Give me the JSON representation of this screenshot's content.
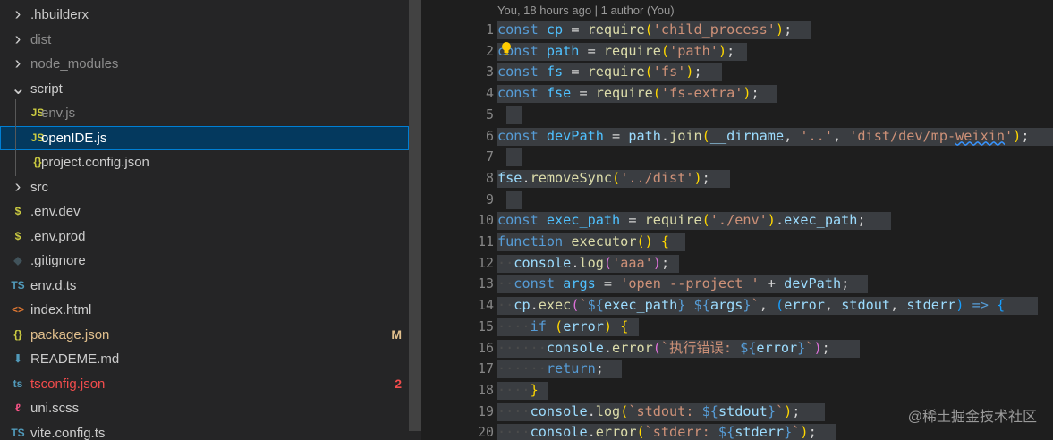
{
  "explorer": {
    "items": [
      {
        "label": ".hbuilderx",
        "kind": "folder",
        "icon": "chevron-right-icon",
        "glyph": "›",
        "depth": 0,
        "color": "#cccccc"
      },
      {
        "label": "dist",
        "kind": "folder",
        "icon": "chevron-right-icon",
        "glyph": "›",
        "depth": 0,
        "color": "#8c8c8c"
      },
      {
        "label": "node_modules",
        "kind": "folder",
        "icon": "chevron-right-icon",
        "glyph": "›",
        "depth": 0,
        "color": "#8c8c8c"
      },
      {
        "label": "script",
        "kind": "folder-open",
        "icon": "chevron-down-icon",
        "glyph": "⌄",
        "depth": 0,
        "color": "#cccccc"
      },
      {
        "label": "env.js",
        "kind": "file",
        "icon": "js-file-icon",
        "glyph": "JS",
        "iconColor": "#cbcb41",
        "depth": 1,
        "color": "#8c8c8c"
      },
      {
        "label": "openIDE.js",
        "kind": "file",
        "icon": "js-file-icon",
        "glyph": "JS",
        "iconColor": "#cbcb41",
        "depth": 1,
        "color": "#ffffff",
        "selected": true
      },
      {
        "label": "project.config.json",
        "kind": "file",
        "icon": "json-file-icon",
        "glyph": "{}",
        "iconColor": "#cbcb41",
        "depth": 1,
        "color": "#cccccc"
      },
      {
        "label": "src",
        "kind": "folder",
        "icon": "chevron-right-icon",
        "glyph": "›",
        "depth": 0,
        "color": "#cccccc"
      },
      {
        "label": ".env.dev",
        "kind": "file",
        "icon": "env-file-icon",
        "glyph": "$",
        "iconColor": "#cbcb41",
        "depth": 0,
        "color": "#cccccc"
      },
      {
        "label": ".env.prod",
        "kind": "file",
        "icon": "env-file-icon",
        "glyph": "$",
        "iconColor": "#cbcb41",
        "depth": 0,
        "color": "#cccccc"
      },
      {
        "label": ".gitignore",
        "kind": "file",
        "icon": "git-file-icon",
        "glyph": "◆",
        "iconColor": "#41535b",
        "depth": 0,
        "color": "#cccccc"
      },
      {
        "label": "env.d.ts",
        "kind": "file",
        "icon": "ts-file-icon",
        "glyph": "TS",
        "iconColor": "#519aba",
        "depth": 0,
        "color": "#cccccc"
      },
      {
        "label": "index.html",
        "kind": "file",
        "icon": "html-file-icon",
        "glyph": "<>",
        "iconColor": "#e37933",
        "depth": 0,
        "color": "#cccccc"
      },
      {
        "label": "package.json",
        "kind": "file",
        "icon": "json-file-icon",
        "glyph": "{}",
        "iconColor": "#cbcb41",
        "depth": 0,
        "color": "#e2c08d",
        "badge": "M",
        "badgeColor": "#e2c08d"
      },
      {
        "label": "READEME.md",
        "kind": "file",
        "icon": "markdown-file-icon",
        "glyph": "⬇",
        "iconColor": "#519aba",
        "depth": 0,
        "color": "#cccccc"
      },
      {
        "label": "tsconfig.json",
        "kind": "file",
        "icon": "ts-config-icon",
        "glyph": "ts",
        "iconColor": "#519aba",
        "depth": 0,
        "color": "#f14c4c",
        "badge": "2",
        "badgeColor": "#f14c4c"
      },
      {
        "label": "uni.scss",
        "kind": "file",
        "icon": "sass-file-icon",
        "glyph": "ℓ",
        "iconColor": "#f55385",
        "depth": 0,
        "color": "#cccccc"
      },
      {
        "label": "vite.config.ts",
        "kind": "file",
        "icon": "ts-file-icon",
        "glyph": "TS",
        "iconColor": "#519aba",
        "depth": 0,
        "color": "#cccccc"
      }
    ]
  },
  "editor": {
    "codelens": "You, 18 hours ago | 1 author (You)",
    "highlight_color": "#3a3d41",
    "lines": [
      {
        "n": "1",
        "hl": [
          0,
          350
        ],
        "tokens": [
          [
            "keyword",
            "const"
          ],
          [
            "op",
            " "
          ],
          [
            "var",
            "cp"
          ],
          [
            "op",
            " = "
          ],
          [
            "func",
            "require"
          ],
          [
            "brace1",
            "("
          ],
          [
            "string",
            "'child_process'"
          ],
          [
            "brace1",
            ")"
          ],
          [
            "op",
            ";"
          ]
        ]
      },
      {
        "n": "2",
        "hl": [
          0,
          279
        ],
        "tokens": [
          [
            "keyword",
            "const"
          ],
          [
            "op",
            " "
          ],
          [
            "var",
            "path"
          ],
          [
            "op",
            " = "
          ],
          [
            "func",
            "require"
          ],
          [
            "brace1",
            "("
          ],
          [
            "string",
            "'path'"
          ],
          [
            "brace1",
            ")"
          ],
          [
            "op",
            ";"
          ]
        ]
      },
      {
        "n": "3",
        "hl": [
          0,
          251
        ],
        "tokens": [
          [
            "keyword",
            "const"
          ],
          [
            "op",
            " "
          ],
          [
            "var",
            "fs"
          ],
          [
            "op",
            " = "
          ],
          [
            "func",
            "require"
          ],
          [
            "brace1",
            "("
          ],
          [
            "string",
            "'fs'"
          ],
          [
            "brace1",
            ")"
          ],
          [
            "op",
            ";"
          ]
        ]
      },
      {
        "n": "4",
        "hl": [
          0,
          313
        ],
        "tokens": [
          [
            "keyword",
            "const"
          ],
          [
            "op",
            " "
          ],
          [
            "var",
            "fse"
          ],
          [
            "op",
            " = "
          ],
          [
            "func",
            "require"
          ],
          [
            "brace1",
            "("
          ],
          [
            "string",
            "'fs-extra'"
          ],
          [
            "brace1",
            ")"
          ],
          [
            "op",
            ";"
          ]
        ]
      },
      {
        "n": "5",
        "hl": [
          10,
          28
        ],
        "tokens": []
      },
      {
        "n": "6",
        "hl": [
          0,
          621
        ],
        "tokens": [
          [
            "keyword",
            "const"
          ],
          [
            "op",
            " "
          ],
          [
            "var",
            "devPath"
          ],
          [
            "op",
            " = "
          ],
          [
            "param",
            "path"
          ],
          [
            "op",
            "."
          ],
          [
            "func",
            "join"
          ],
          [
            "brace1",
            "("
          ],
          [
            "param",
            "__dirname"
          ],
          [
            "op",
            ", "
          ],
          [
            "string",
            "'..'"
          ],
          [
            "op",
            ", "
          ],
          [
            "string",
            "'dist/dev/mp-"
          ],
          [
            "squiggle",
            "weixin"
          ],
          [
            "string",
            "'"
          ],
          [
            "brace1",
            ")"
          ],
          [
            "op",
            ";"
          ]
        ]
      },
      {
        "n": "7",
        "hl": [
          10,
          28
        ],
        "tokens": []
      },
      {
        "n": "8",
        "hl": [
          0,
          260
        ],
        "tokens": [
          [
            "param",
            "fse"
          ],
          [
            "op",
            "."
          ],
          [
            "func",
            "removeSync"
          ],
          [
            "brace1",
            "("
          ],
          [
            "string",
            "'../dist'"
          ],
          [
            "brace1",
            ")"
          ],
          [
            "op",
            ";"
          ]
        ]
      },
      {
        "n": "9",
        "hl": [
          10,
          28
        ],
        "tokens": []
      },
      {
        "n": "10",
        "hl": [
          0,
          440
        ],
        "tokens": [
          [
            "keyword",
            "const"
          ],
          [
            "op",
            " "
          ],
          [
            "var",
            "exec_path"
          ],
          [
            "op",
            " = "
          ],
          [
            "func",
            "require"
          ],
          [
            "brace1",
            "("
          ],
          [
            "string",
            "'./env'"
          ],
          [
            "brace1",
            ")"
          ],
          [
            "op",
            "."
          ],
          [
            "param",
            "exec_path"
          ],
          [
            "op",
            ";"
          ]
        ]
      },
      {
        "n": "11",
        "hl": [
          0,
          210
        ],
        "tokens": [
          [
            "keyword",
            "function"
          ],
          [
            "op",
            " "
          ],
          [
            "func",
            "executor"
          ],
          [
            "brace1",
            "()"
          ],
          [
            "op",
            " "
          ],
          [
            "brace1",
            "{"
          ]
        ]
      },
      {
        "n": "12",
        "hl": [
          0,
          203
        ],
        "tokens": [
          [
            "ws",
            "··"
          ],
          [
            "param",
            "console"
          ],
          [
            "op",
            "."
          ],
          [
            "func",
            "log"
          ],
          [
            "brace2",
            "("
          ],
          [
            "string",
            "'aaa'"
          ],
          [
            "brace2",
            ")"
          ],
          [
            "op",
            ";"
          ]
        ]
      },
      {
        "n": "13",
        "hl": [
          0,
          414
        ],
        "tokens": [
          [
            "ws",
            "··"
          ],
          [
            "keyword",
            "const"
          ],
          [
            "op",
            " "
          ],
          [
            "var",
            "args"
          ],
          [
            "op",
            " = "
          ],
          [
            "string",
            "'open --project '"
          ],
          [
            "op",
            " + "
          ],
          [
            "param",
            "devPath"
          ],
          [
            "op",
            ";"
          ]
        ]
      },
      {
        "n": "14",
        "hl": [
          0,
          604
        ],
        "tokens": [
          [
            "ws",
            "··"
          ],
          [
            "param",
            "cp"
          ],
          [
            "op",
            "."
          ],
          [
            "func",
            "exec"
          ],
          [
            "brace2",
            "("
          ],
          [
            "string",
            "`"
          ],
          [
            "keyword",
            "${"
          ],
          [
            "param",
            "exec_path"
          ],
          [
            "keyword",
            "}"
          ],
          [
            "string",
            " "
          ],
          [
            "keyword",
            "${"
          ],
          [
            "param",
            "args"
          ],
          [
            "keyword",
            "}"
          ],
          [
            "string",
            "`"
          ],
          [
            "op",
            ", "
          ],
          [
            "brace3",
            "("
          ],
          [
            "param",
            "error"
          ],
          [
            "op",
            ", "
          ],
          [
            "param",
            "stdout"
          ],
          [
            "op",
            ", "
          ],
          [
            "param",
            "stderr"
          ],
          [
            "brace3",
            ")"
          ],
          [
            "op",
            " "
          ],
          [
            "keyword",
            "=>"
          ],
          [
            "op",
            " "
          ],
          [
            "brace3",
            "{"
          ]
        ]
      },
      {
        "n": "15",
        "hl": [
          0,
          158
        ],
        "tokens": [
          [
            "ws",
            "····"
          ],
          [
            "keyword",
            "if"
          ],
          [
            "op",
            " "
          ],
          [
            "brace1",
            "("
          ],
          [
            "param",
            "error"
          ],
          [
            "brace1",
            ")"
          ],
          [
            "op",
            " "
          ],
          [
            "brace1",
            "{"
          ]
        ]
      },
      {
        "n": "16",
        "hl": [
          0,
          405
        ],
        "tokens": [
          [
            "ws",
            "······"
          ],
          [
            "param",
            "console"
          ],
          [
            "op",
            "."
          ],
          [
            "func",
            "error"
          ],
          [
            "brace2",
            "("
          ],
          [
            "string",
            "`执行错误: "
          ],
          [
            "keyword",
            "${"
          ],
          [
            "param",
            "error"
          ],
          [
            "keyword",
            "}"
          ],
          [
            "string",
            "`"
          ],
          [
            "brace2",
            ")"
          ],
          [
            "op",
            ";"
          ]
        ]
      },
      {
        "n": "17",
        "hl": [
          0,
          139
        ],
        "tokens": [
          [
            "ws",
            "······"
          ],
          [
            "keyword",
            "return"
          ],
          [
            "op",
            ";"
          ]
        ]
      },
      {
        "n": "18",
        "hl": [
          0,
          56
        ],
        "tokens": [
          [
            "ws",
            "····"
          ],
          [
            "brace1",
            "}"
          ]
        ]
      },
      {
        "n": "19",
        "hl": [
          0,
          366
        ],
        "tokens": [
          [
            "ws",
            "····"
          ],
          [
            "param",
            "console"
          ],
          [
            "op",
            "."
          ],
          [
            "func",
            "log"
          ],
          [
            "brace1",
            "("
          ],
          [
            "string",
            "`stdout: "
          ],
          [
            "keyword",
            "${"
          ],
          [
            "param",
            "stdout"
          ],
          [
            "keyword",
            "}"
          ],
          [
            "string",
            "`"
          ],
          [
            "brace1",
            ")"
          ],
          [
            "op",
            ";"
          ]
        ]
      },
      {
        "n": "20",
        "hl": [
          0,
          378
        ],
        "tokens": [
          [
            "ws",
            "····"
          ],
          [
            "param",
            "console"
          ],
          [
            "op",
            "."
          ],
          [
            "func",
            "error"
          ],
          [
            "brace1",
            "("
          ],
          [
            "string",
            "`stderr: "
          ],
          [
            "keyword",
            "${"
          ],
          [
            "param",
            "stderr"
          ],
          [
            "keyword",
            "}"
          ],
          [
            "string",
            "`"
          ],
          [
            "brace1",
            ")"
          ],
          [
            "op",
            ";"
          ]
        ]
      }
    ]
  },
  "watermark": "@稀土掘金技术社区"
}
